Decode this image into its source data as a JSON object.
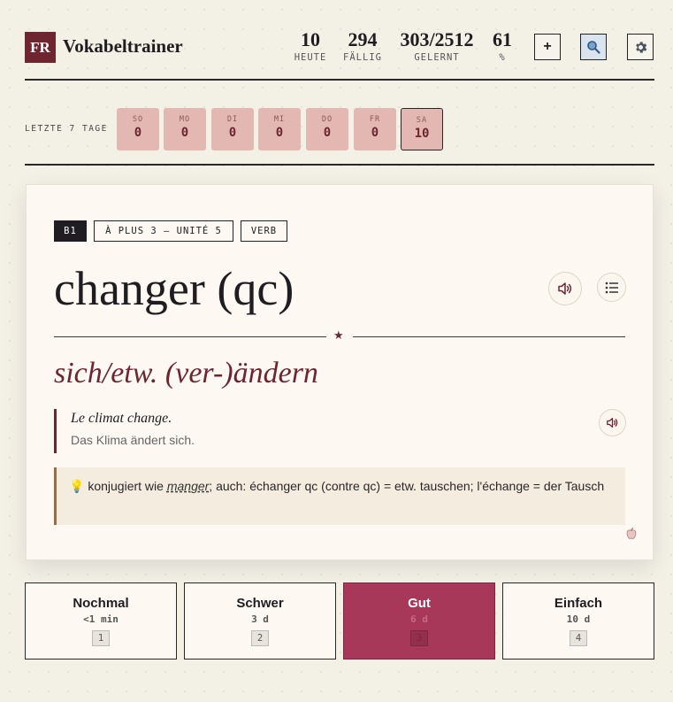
{
  "app": {
    "logo_text": "FR",
    "title": "Vokabeltrainer"
  },
  "stats": [
    {
      "value": "10",
      "label": "HEUTE"
    },
    {
      "value": "294",
      "label": "FÄLLIG"
    },
    {
      "value": "303/2512",
      "label": "GELERNT"
    },
    {
      "value": "61",
      "label": "%"
    }
  ],
  "toolbar": {
    "add_label": "+",
    "search_icon": "search-icon",
    "settings_icon": "gear-icon"
  },
  "history": {
    "label": "LETZTE 7 TAGE",
    "days": [
      {
        "name": "SO",
        "count": "0"
      },
      {
        "name": "MO",
        "count": "0"
      },
      {
        "name": "DI",
        "count": "0"
      },
      {
        "name": "MI",
        "count": "0"
      },
      {
        "name": "DO",
        "count": "0"
      },
      {
        "name": "FR",
        "count": "0"
      },
      {
        "name": "SA",
        "count": "10"
      }
    ]
  },
  "card": {
    "tags": [
      "B1",
      "À PLUS 3 – UNITÉ 5",
      "VERB"
    ],
    "word": "changer (qc)",
    "separator": "★",
    "translation": "sich/etw. (ver-)ändern",
    "example_fr": "Le climat change.",
    "example_de": "Das Klima ändert sich.",
    "note_icon": "💡",
    "note_prefix": "konjugiert wie",
    "note_link": "manger",
    "note_suffix": "; auch: échanger qc (contre qc) = etw. tauschen; l'échange = der Tausch"
  },
  "answers": [
    {
      "label": "Nochmal",
      "interval": "<1 min",
      "key": "1"
    },
    {
      "label": "Schwer",
      "interval": "3 d",
      "key": "2"
    },
    {
      "label": "Gut",
      "interval": "6 d",
      "key": "3"
    },
    {
      "label": "Einfach",
      "interval": "10 d",
      "key": "4"
    }
  ],
  "colors": {
    "accent": "#6e2530",
    "primary_button": "#a8385a",
    "day_tile": "#e3b8b2",
    "background": "#f3f0e6"
  }
}
